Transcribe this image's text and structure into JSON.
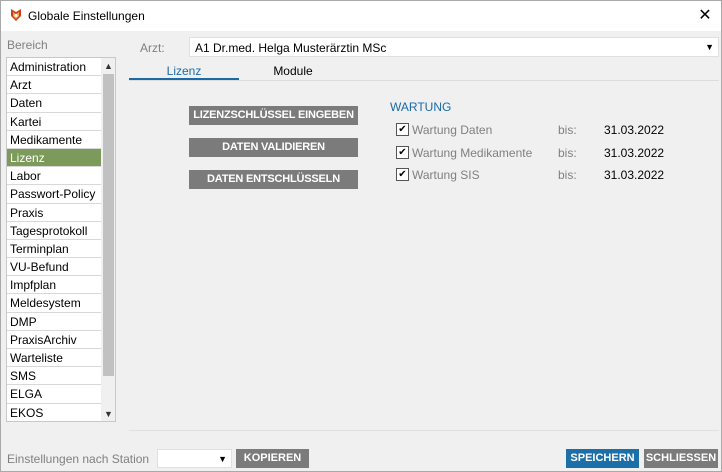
{
  "window": {
    "title": "Globale Einstellungen",
    "close_glyph": "✕"
  },
  "sidebar": {
    "label": "Bereich",
    "selected": "Lizenz",
    "items": [
      "Administration",
      "Arzt",
      "Daten",
      "Kartei",
      "Medikamente",
      "Lizenz",
      "Labor",
      "Passwort-Policy",
      "Praxis",
      "Tagesprotokoll",
      "Terminplan",
      "VU-Befund",
      "Impfplan",
      "Meldesystem",
      "DMP",
      "PraxisArchiv",
      "Warteliste",
      "SMS",
      "ELGA",
      "EKOS"
    ]
  },
  "arzt": {
    "label": "Arzt:",
    "value": "A1 Dr.med. Helga Musterärztin MSc"
  },
  "tabs": {
    "lizenz": "Lizenz",
    "module": "Module",
    "active": "Lizenz"
  },
  "actions": {
    "key_label": "LIZENZSCHLÜSSEL EINGEBEN",
    "validate_label": "DATEN VALIDIEREN",
    "decrypt_label": "DATEN ENTSCHLÜSSELN"
  },
  "wartung": {
    "title": "WARTUNG",
    "rows": [
      {
        "label": "Wartung Daten",
        "bis": "bis:",
        "date": "31.03.2022",
        "checked": true
      },
      {
        "label": "Wartung Medikamente",
        "bis": "bis:",
        "date": "31.03.2022",
        "checked": true
      },
      {
        "label": "Wartung SIS",
        "bis": "bis:",
        "date": "31.03.2022",
        "checked": true
      }
    ]
  },
  "footer": {
    "station_label": "Einstellungen nach Station",
    "station_value": "",
    "copy_label": "KOPIEREN",
    "save_label": "SPEICHERN",
    "close_label": "SCHLIESSEN"
  },
  "colors": {
    "accent": "#1a6aa8",
    "selected_item": "#7c9a59",
    "button_gray": "#7b7b7b",
    "button_primary": "#1d6fa8"
  },
  "icons": {
    "app": "app-logo-icon",
    "close": "close-icon",
    "scroll_up": "chevron-up-icon",
    "scroll_down": "chevron-down-icon",
    "dropdown": "chevron-down-icon",
    "checkbox": "checkmark-icon"
  }
}
